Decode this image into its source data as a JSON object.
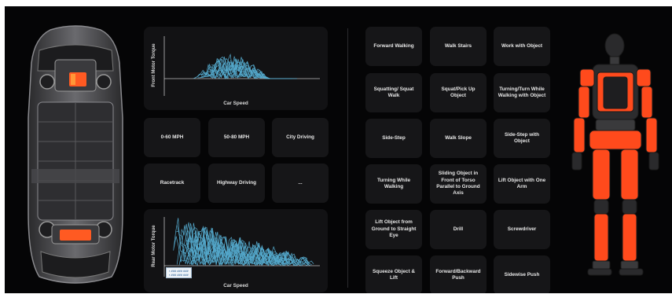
{
  "colors": {
    "background": "#050506",
    "panel": "#121214",
    "tile": "#161618",
    "text": "#e6e6e6",
    "trace": "#5bb8de",
    "actuator": "#ff4a1c"
  },
  "car_panel": {
    "front_plot": {
      "ylabel": "Front Motor Torque",
      "xlabel": "Car Speed"
    },
    "rear_plot": {
      "ylabel": "Rear Motor Torque",
      "xlabel": "Car Speed",
      "legend": [
        "▪ ### ### ###",
        "▪ ### ### ###"
      ]
    },
    "tiles": [
      "0-60 MPH",
      "50-80 MPH",
      "City Driving",
      "Racetrack",
      "Highway Driving",
      "..."
    ]
  },
  "robot_panel": {
    "tiles": [
      "Forward Walking",
      "Walk Stairs",
      "Work with Object",
      "Squatting/ Squat Walk",
      "Squat/Pick Up Object",
      "Turning/Turn While Walking with Object",
      "Side-Step",
      "Walk Slope",
      "Side-Step with Object",
      "Turning While Walking",
      "Sliding Object in Front of Torso Parallel to Ground Axis",
      "Lift Object with One Arm",
      "Lift Object from Ground to Straight Eye",
      "Drill",
      "Screwdriver",
      "Squeeze Object & Lift",
      "Forward/Backward Push",
      "Sidewise Push"
    ]
  },
  "icons": {
    "car": "car-chassis-icon",
    "robot": "humanoid-robot-icon"
  }
}
